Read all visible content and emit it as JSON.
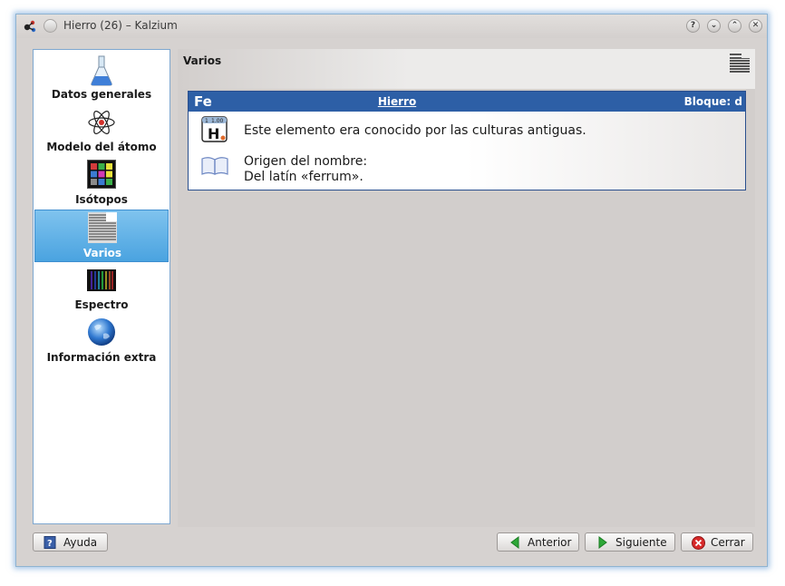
{
  "window": {
    "title": "Hierro (26) – Kalzium",
    "buttons": [
      "?",
      "⌄",
      "⌃",
      "✕"
    ]
  },
  "sidebar": {
    "items": [
      {
        "label": "Datos generales",
        "icon": "flask-icon"
      },
      {
        "label": "Modelo del átomo",
        "icon": "atom-icon"
      },
      {
        "label": "Isótopos",
        "icon": "isotopes-grid-icon"
      },
      {
        "label": "Varios",
        "icon": "misc-lines-icon",
        "selected": true
      },
      {
        "label": "Espectro",
        "icon": "spectrum-icon"
      },
      {
        "label": "Información extra",
        "icon": "globe-icon"
      }
    ]
  },
  "page": {
    "title": "Varios"
  },
  "element": {
    "symbol": "Fe",
    "name": "Hierro",
    "block": "Bloque: d",
    "tile_number": "1",
    "tile_mass": "1.00",
    "tile_symbol": "H",
    "known_since": "Este elemento era conocido por las culturas antiguas.",
    "origin_label": "Origen del nombre:",
    "origin_value": "Del latín «ferrum»."
  },
  "buttons": {
    "help": "Ayuda",
    "previous": "Anterior",
    "next": "Siguiente",
    "close": "Cerrar"
  },
  "colors": {
    "selection": "#4aa3e0",
    "header_blue": "#2d5fa6",
    "window_bg": "#d6d2d0"
  }
}
